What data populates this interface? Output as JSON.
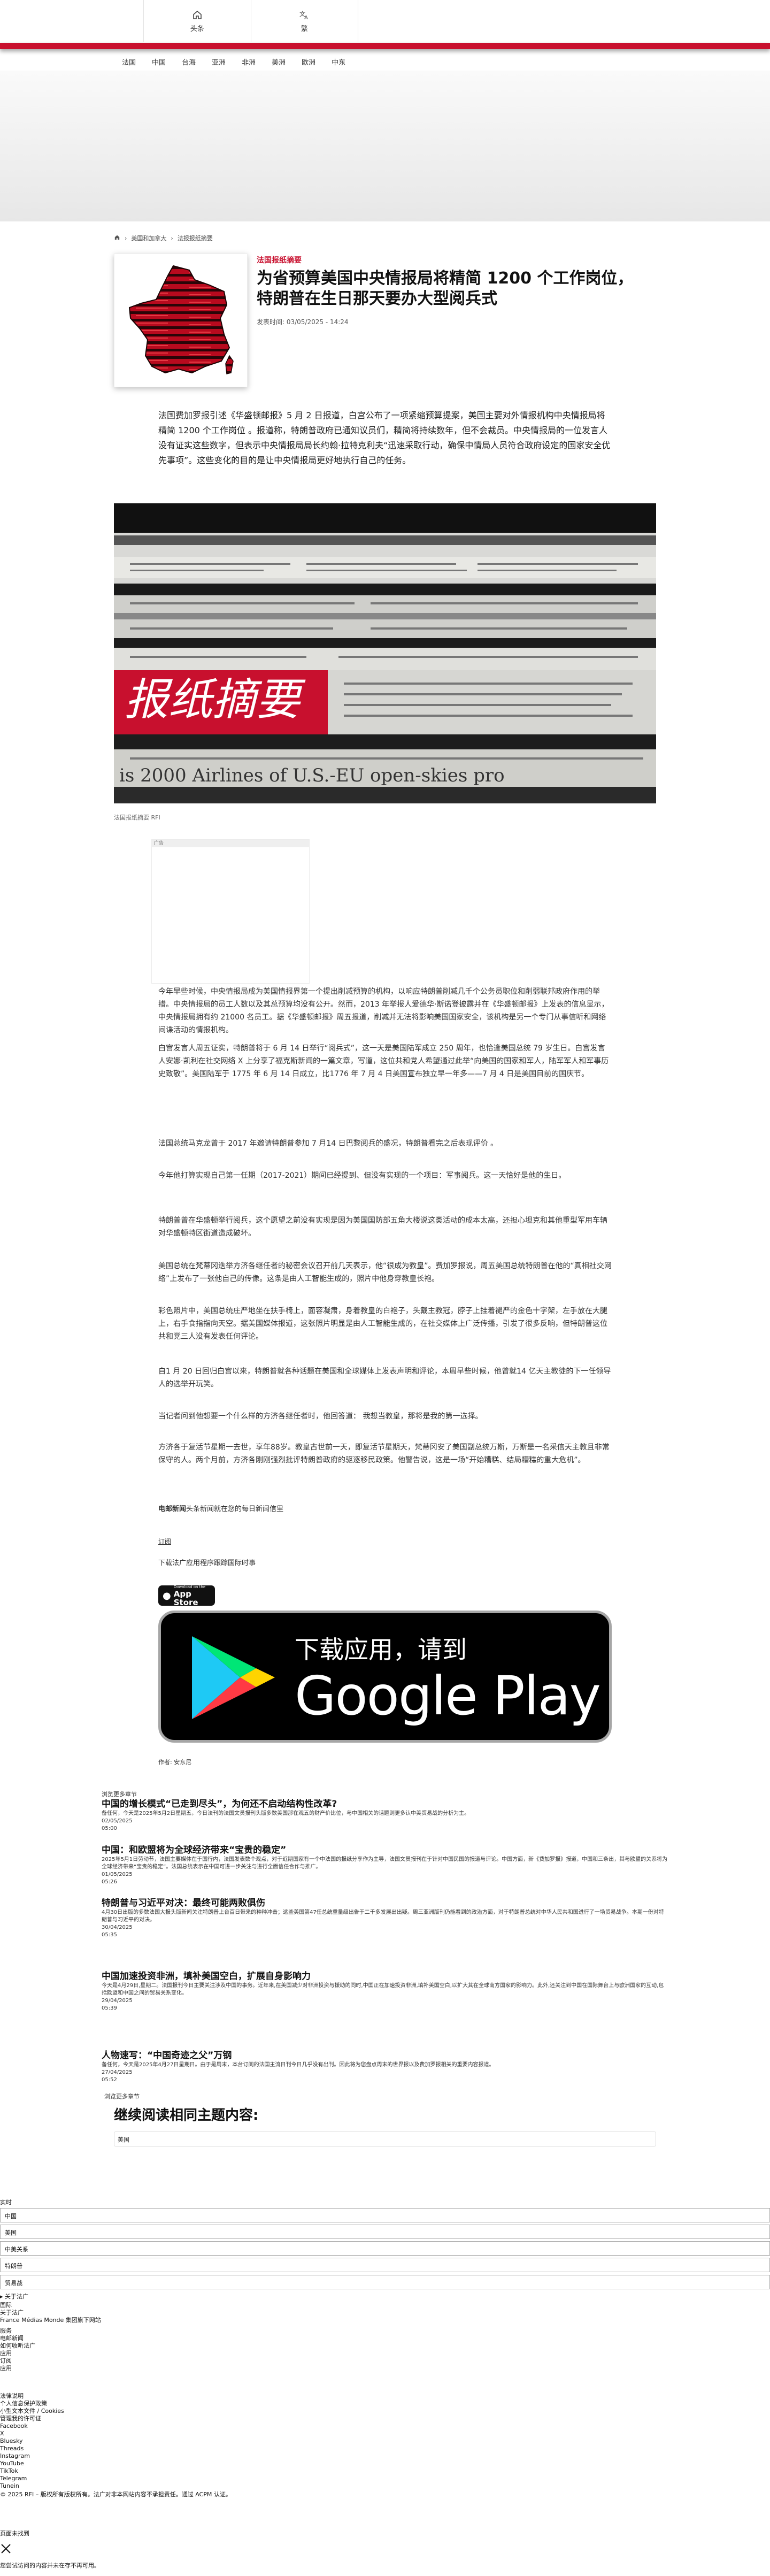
{
  "topnav": {
    "home": "头条",
    "lang": "繁"
  },
  "subnav": [
    "法国",
    "中国",
    "台海",
    "亚洲",
    "非洲",
    "美洲",
    "欧洲",
    "中东"
  ],
  "breadcrumb": {
    "item1": "美国和加拿大",
    "item2": "法报报纸摘要"
  },
  "article": {
    "kicker": "法国报纸摘要",
    "title": "为省预算美国中央情报局将精简 1200 个工作岗位， 特朗普在生日那天要办大型阅兵式",
    "meta": "发表时间:   03/05/2025 - 14:24",
    "lead": "法国费加罗报引述《华盛顿邮报》5 月 2 日报道，白宫公布了一项紧缩预算提案，美国主要对外情报机构中央情报局将精简 1200 个工作岗位 。报道称，特朗普政府已通知议员们，精简将持续数年，但不会裁员。中央情报局的一位发言人没有证实这些数字，但表示中央情报局局长约翰·拉特克利夫“迅速采取行动，确保中情局人员符合政府设定的国家安全优先事项”。这些变化的目的是让中央情报局更好地执行自己的任务。",
    "photo_caption": "法国报纸摘要   RFI",
    "ad_label": "广告",
    "paragraphs": [
      "今年早些时候，中央情报局成为美国情报界第一个提出削减预算的机构，以响应特朗普削减几千个公务员职位和削弱联邦政府作用的举措。中央情报局的员工人数以及其总预算均没有公开。然而，2013 年举报人爱德华·斯诺登披露并在《华盛顿邮报》上发表的信息显示，中央情报局拥有约 21000 名员工。据《华盛顿邮报》周五报道，削减并无法将影响美国国家安全，该机构是另一个专门从事信听和网络间谍活动的情报机构。",
      "白宫发言人周五证实，特朗普将于 6 月 14 日举行“阅兵式”，这一天是美国陆军成立 250 周年，也恰逢美国总统 79 岁生日。白宫发言人安娜·凯利在社交网络 X 上分享了福克斯新闻的一篇文章，写道，这位共和党人希望通过此举“向美国的国家和军人，陆军军人和军事历史致敬”。美国陆军于 1775 年 6 月 14 日成立，比1776 年 7 月 4 日美国宣布独立早一年多——7 月 4 日是美国目前的国庆节。",
      "法国总统马克龙曾于 2017 年邀请特朗普参加 7 月14 日巴黎阅兵的盛况，特朗普看完之后表现评价 。",
      "今年他打算实现自己第一任期（2017-2021）期间已经提到、但没有实现的一个项目：军事阅兵。这一天恰好是他的生日。",
      "特朗普曾在华盛顿举行阅兵，这个愿望之前没有实现是因为美国国防部五角大楼说这类活动的成本太高，还担心坦克和其他重型军用车辆对华盛顿特区街道造成破坏。",
      "美国总统在梵蒂冈迭举方济各继任者的秘密会议召开前几天表示，他“很成为教皇”。费加罗报说，周五美国总统特朗普在他的“真相社交网络”上发布了一张他自己的传像。这条是由人工智能生成的，照片中他身穿教皇长袍。",
      "彩色照片中，美国总统庄严地坐在扶手椅上，面容凝肃，身着教皇的白袍子，头戴主教冠，脖子上挂着褪严的金色十字架，左手放在大腿上，右手食指指向天空。据美国媒体报道，这张照片明显是由人工智能生成的，在社交媒体上广泛传播，引发了很多反响，但特朗普这位共和党三人没有发表任何评论。",
      "自1 月 20 日回归白宫以来，特朗普就各种话题在美国和全球媒体上发表声明和评论，本周早些时候，他曾就14 亿天主教徒的下一任领导人的选举开玩笑。",
      "当记者问到他想要一个什么样的方济各继任者时，他回答道：  我想当教皇，那将是我的第一选择。",
      "方济各于复活节星期一去世，享年88岁。教皇古世前一天，即复活节星期天，梵蒂冈安了美国副总统万斯，万斯是一名采信天主教且非常保守的人。两个月前，方济各刚刚强烈批评特朗普政府的驱逐移民政策。他警告说，这是一场“开始糟糕、结局糟糕的重大危机”。"
    ],
    "subscribe_bold": "电邮新闻",
    "subscribe_text": "头条新闻就在您的每日新闻信里",
    "subscribe_link": "订阅",
    "download_text": "下载法广应用程序跟踪国际时事",
    "appstore_line1": "Download on the",
    "appstore_line2": "App Store",
    "gplay_line1": "下载应用，请到",
    "gplay_line2": "Google Play",
    "author": "作者:   安东尼"
  },
  "related_label": "浏览更多章节",
  "related": [
    {
      "title": "中国的增长模式“已走到尽头”，为何还不启动结构性改革?",
      "text": "备任何，今天是2025年5月2日星期五，今日法刊的法国文员报刊头版多数美国那在观五的财产价比位，与中国相关的话题则更多认中美贸易战的分析为主。",
      "date": "02/05/2025",
      "time": "05:00"
    },
    {
      "title": "中国：和欧盟将为全球经济带来“宝贵的稳定”",
      "text": "2025年5月1日劳动节，法国主要媒体在于国行内，法国发表数个观点，对于近期国家有一个中法国的报纸分享作为主导，法国文员报刊在于针对中国民国的报道与评论。中国方面，新《费加罗报》报道，中国和三条出，其与欧盟的关系将为全球经济带来“宝贵的稳定”。法国总统表示在中国可进一步关注与进行全面信任合作与推广。",
      "date": "01/05/2025",
      "time": "05:26"
    },
    {
      "title": "特朗普与习近平对决：最终可能两败俱伤",
      "text": "4月30日出版的多数法国大报头版新闻关注特朗普上台百日带来的种种冲击；这些美国第47任总统重量级出告于二千多发展出出疑。周三亚洲版刊仍能看到的政治方面，对于特朗普总统对中华人民共和国进行了一场贸易战争。本期一份对特朗普与习近平的对决。",
      "date": "30/04/2025",
      "time": "05:35"
    },
    {
      "title": "中国加速投资非洲，填补美国空白，扩展自身影响力",
      "text": "今天是4月29日,星期二。法国报刊今日主要关注涉及中国的事务。近年来,在美国减少对非洲投资与援助的同时,中国正在加速投资非洲,填补美国空白,以扩大其在全球南方国家的影响力。此外,还关注到中国在国际舞台上与欧洲国家的互动,包括欧盟和中国之间的贸易关系变化。",
      "date": "29/04/2025",
      "time": "05:39"
    },
    {
      "title": "人物速写：“中国奇迹之父”万钢",
      "text": "备任何，今天是2025年4月27日星期日。由于是周末，本台订阅的法国主流日刊今日几乎没有出刊。因此将为您盘点周末的世界报以及费加罗报相关的重要内容报道。",
      "date": "27/04/2025",
      "time": "05:52"
    }
  ],
  "more_label": "浏览更多章节",
  "continue_title": "继续阅读相同主题内容:",
  "continue_tag": "美国",
  "footer": {
    "realtime": "实时",
    "inputs": [
      "中国",
      "美国",
      "中美关系",
      "特朗普",
      "贸易战"
    ],
    "about": "关于法广",
    "links1": [
      "国际",
      "关于法广",
      "France Médias Monde 集团旗下网站"
    ],
    "links2": [
      "服务",
      "电邮新闻",
      "如何收听法广",
      "应用",
      "订阅",
      "应用"
    ],
    "links3": [
      "法律说明",
      "个人信息保护政策",
      "小型文本文件 / Cookies",
      "管理我的许可证",
      "Facebook",
      "X",
      "Bluesky",
      "Threads",
      "Instagram",
      "YouTube",
      "TikTok",
      "Telegram",
      "Tunein"
    ],
    "copyright": "© 2025 RFI – 版权所有版权所有。法广对非本网站内容不承担责任。通过 ACPM 认证。",
    "search_label": "页面未找到",
    "notice": "您尝试访问的内容并未在存不再可用。"
  },
  "colors": {
    "brand": "#c8102e",
    "text": "#111111"
  }
}
